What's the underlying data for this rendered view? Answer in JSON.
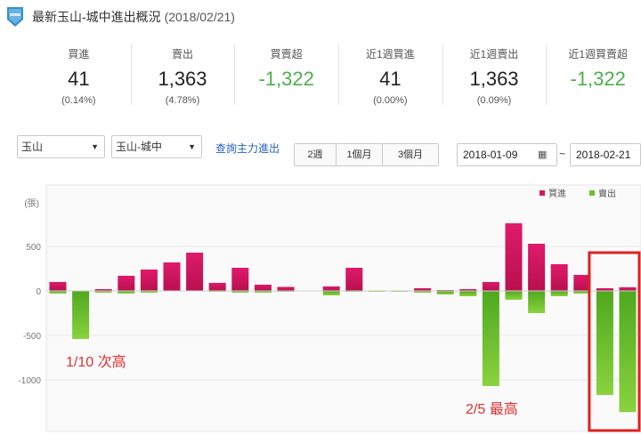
{
  "header": {
    "badge_icon": "shield-badge-icon",
    "title": "最新玉山-城中進出概況",
    "date": "(2018/02/21)"
  },
  "stats": [
    {
      "label": "買進",
      "value": "41",
      "sub": "(0.14%)",
      "negative": false
    },
    {
      "label": "賣出",
      "value": "1,363",
      "sub": "(4.78%)",
      "negative": false
    },
    {
      "label": "買賣超",
      "value": "-1,322",
      "sub": "",
      "negative": true
    },
    {
      "label": "近1週買進",
      "value": "41",
      "sub": "(0.00%)",
      "negative": false
    },
    {
      "label": "近1週賣出",
      "value": "1,363",
      "sub": "(0.09%)",
      "negative": false
    },
    {
      "label": "近1週買賣超",
      "value": "-1,322",
      "sub": "",
      "negative": true
    }
  ],
  "controls": {
    "broker_select": "玉山",
    "branch_select": "玉山-城中",
    "query_link": "查詢主力進出",
    "period_buttons": [
      "2週",
      "1個月",
      "3個月"
    ],
    "start_date": "2018-01-09",
    "end_date": "2018-02-21",
    "range_separator": "~",
    "calendar_icon": "calendar-icon"
  },
  "chart_data": {
    "type": "bar",
    "ylabel": "(張)",
    "yticks": [
      500,
      0,
      -500,
      -1000
    ],
    "ylim": [
      -1400,
      900
    ],
    "legend": [
      "買進",
      "賣出"
    ],
    "legend_position": "top-right",
    "colors": {
      "buy": "#d6145f",
      "sell": "#6cc02c"
    },
    "series": [
      {
        "name": "買進",
        "values": [
          100,
          0,
          20,
          170,
          240,
          320,
          430,
          90,
          260,
          70,
          45,
          0,
          50,
          260,
          0,
          0,
          30,
          10,
          20,
          100,
          760,
          530,
          300,
          180,
          30,
          41
        ]
      },
      {
        "name": "賣出",
        "values": [
          -30,
          -540,
          -20,
          -30,
          -20,
          0,
          0,
          -10,
          -20,
          -20,
          -10,
          -5,
          -50,
          -10,
          -10,
          -10,
          -20,
          -40,
          -60,
          -1070,
          -100,
          -250,
          -60,
          -30,
          -1170,
          -1363
        ]
      }
    ],
    "annotations": [
      {
        "text": "1/10 次高",
        "bar_index": 1
      },
      {
        "text": "2/5 最高",
        "bar_index": 19
      }
    ],
    "highlight_bars": [
      24,
      25
    ]
  }
}
